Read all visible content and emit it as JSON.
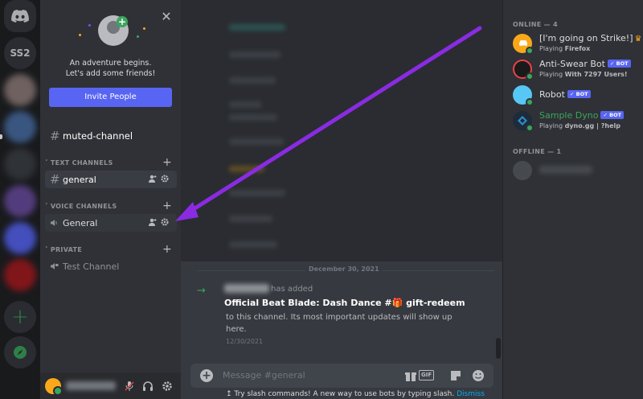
{
  "servers": {
    "abbrev": "SS2"
  },
  "invite_card": {
    "line1": "An adventure begins.",
    "line2": "Let's add some friends!",
    "button_label": "Invite People"
  },
  "channels": {
    "muted": "muted-channel",
    "categories": {
      "text": "TEXT CHANNELS",
      "voice": "VOICE CHANNELS",
      "private": "PRIVATE"
    },
    "text_general": "general",
    "voice_general": "General",
    "test": "Test Channel"
  },
  "chat": {
    "date_divider": "December 30, 2021",
    "system": {
      "action": "has added",
      "title": "Official Beat Blade: Dash Dance #🎁 gift-redeem",
      "body": "to this channel. Its most important updates will show up here.",
      "timestamp": "12/30/2021"
    },
    "composer_placeholder": "Message #general",
    "gif_label": "GIF",
    "tip_text": "Try slash commands! A new way to use bots by typing slash.",
    "tip_dismiss": "Dismiss"
  },
  "members": {
    "online_header": "ONLINE — 4",
    "offline_header": "OFFLINE — 1",
    "online": [
      {
        "name": "[I'm going on Strike!]",
        "activity_prefix": "Playing ",
        "activity": "Firefox",
        "bot": false,
        "crown": true,
        "avatar_color": "#faa81a"
      },
      {
        "name": "Anti-Swear Bot",
        "activity_prefix": "Playing ",
        "activity": "With 7297 Users!",
        "bot": true,
        "avatar_color": "#ed4245"
      },
      {
        "name": "Robot",
        "activity_prefix": "",
        "activity": "",
        "bot": true,
        "avatar_color": "#57c7f5"
      },
      {
        "name": "Sample Dyno",
        "activity_prefix": "Playing ",
        "activity": "dyno.gg | ?help",
        "bot": true,
        "avatar_color": "#2d8ec7"
      }
    ],
    "bot_tag": "✓ BOT"
  },
  "colors": {
    "blurple": "#5865f2",
    "green": "#3ba55d",
    "arrow": "#8a2be2",
    "sample_dyno_name": "#3ba55d"
  }
}
